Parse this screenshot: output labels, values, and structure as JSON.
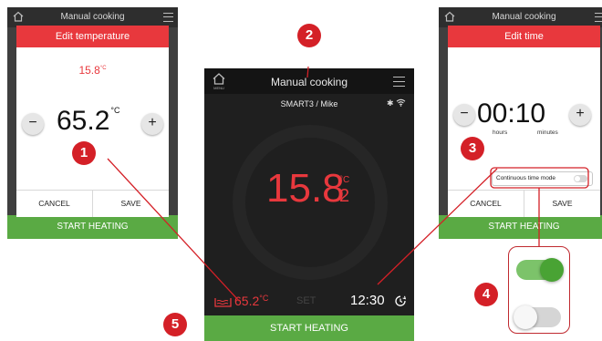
{
  "colors": {
    "accent_red": "#e8383d",
    "marker_red": "#d42027",
    "start_green": "#5aaa44",
    "toggle_on": "#49a334",
    "dark_bg": "#1f1f1f"
  },
  "left_screen": {
    "title": "Manual cooking",
    "dialog_title": "Edit temperature",
    "current_temp": "15.8",
    "current_unit": "°C",
    "value": "65.2",
    "value_unit": "°C",
    "minus": "−",
    "plus": "+",
    "cancel": "CANCEL",
    "save": "SAVE",
    "start": "START HEATING"
  },
  "right_screen": {
    "title": "Manual cooking",
    "dialog_title": "Edit time",
    "value": "00:10",
    "hours_label": "hours",
    "minutes_label": "minutes",
    "minus": "−",
    "plus": "+",
    "continuous_label": "Continuous time mode",
    "continuous_on": false,
    "cancel": "CANCEL",
    "save": "SAVE",
    "start": "START HEATING"
  },
  "center_screen": {
    "title": "Manual cooking",
    "home_label": "MENU",
    "user": "SMART3 / Mike",
    "temp_int": "15.8",
    "temp_dec": "2",
    "temp_unit": "°C",
    "set_temp": "65.2",
    "set_temp_unit": "°C",
    "set_label": "SET",
    "time": "12:30",
    "start": "START HEATING"
  },
  "markers": [
    "1",
    "2",
    "3",
    "4",
    "5"
  ],
  "toggles": {
    "on_state": true,
    "off_state": false
  }
}
